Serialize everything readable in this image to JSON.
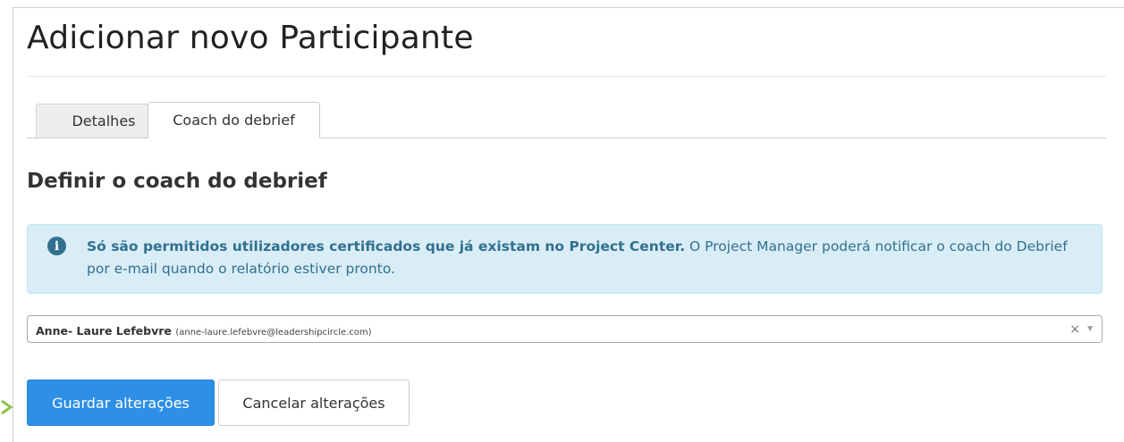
{
  "page": {
    "title": "Adicionar novo Participante"
  },
  "tabs": [
    {
      "label": "Detalhes",
      "active": false
    },
    {
      "label": "Coach do debrief",
      "active": true
    }
  ],
  "section": {
    "heading": "Definir o coach do debrief"
  },
  "alert": {
    "icon": "info-icon",
    "icon_glyph": "i",
    "bold_text": "Só são permitidos utilizadores certificados que já existam no Project Center.",
    "text": " O Project Manager poderá notificar o coach do Debrief por e-mail quando o relatório estiver pronto."
  },
  "coach_select": {
    "selected_name": "Anne- Laure Lefebvre",
    "selected_email": "(anne-laure.lefebvre@leadershipcircle.com)",
    "clear_glyph": "×",
    "arrow_glyph": "▼"
  },
  "actions": {
    "save_label": "Guardar alterações",
    "cancel_label": "Cancelar alterações"
  },
  "colors": {
    "primary": "#2d8fe6",
    "alert_bg": "#d9edf7",
    "alert_text": "#31708f",
    "pointer": "#8bc34a"
  }
}
